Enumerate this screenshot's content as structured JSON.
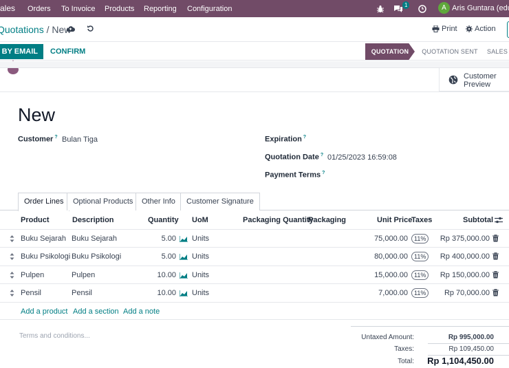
{
  "nav": {
    "app": "Sales",
    "menu": [
      "Orders",
      "To Invoice",
      "Products",
      "Reporting",
      "Configuration"
    ],
    "chat_badge": "1",
    "avatar_letter": "A",
    "user": "Aris Guntara (edu-l"
  },
  "breadcrumb": {
    "parent": "Quotations",
    "sep": "/",
    "current": "New"
  },
  "toolbar": {
    "print": "Print",
    "action": "Action"
  },
  "actions": {
    "send_email": "SEND BY EMAIL",
    "confirm": "CONFIRM"
  },
  "statusbar": {
    "quotation": "QUOTATION",
    "sent": "QUOTATION SENT",
    "sales": "SALES ORDER"
  },
  "preview": {
    "line1": "Customer",
    "line2": "Preview"
  },
  "form": {
    "title": "New",
    "customer_label": "Customer",
    "customer_value": "Bulan Tiga",
    "expiration_label": "Expiration",
    "quotation_date_label": "Quotation Date",
    "quotation_date_value": "01/25/2023 16:59:08",
    "payment_terms_label": "Payment Terms",
    "help": "?"
  },
  "tabs": [
    "Order Lines",
    "Optional Products",
    "Other Info",
    "Customer Signature"
  ],
  "table": {
    "headers": {
      "product": "Product",
      "description": "Description",
      "quantity": "Quantity",
      "uom": "UoM",
      "pkg_qty": "Packaging Quantity",
      "packaging": "Packaging",
      "unit_price": "Unit Price",
      "taxes": "Taxes",
      "subtotal": "Subtotal"
    },
    "rows": [
      {
        "product": "Buku Sejarah",
        "description": "Buku Sejarah",
        "quantity": "5.00",
        "uom": "Units",
        "unit_price": "75,000.00",
        "tax": "11%",
        "subtotal": "Rp 375,000.00"
      },
      {
        "product": "Buku Psikologi",
        "description": "Buku Psikologi",
        "quantity": "5.00",
        "uom": "Units",
        "unit_price": "80,000.00",
        "tax": "11%",
        "subtotal": "Rp 400,000.00"
      },
      {
        "product": "Pulpen",
        "description": "Pulpen",
        "quantity": "10.00",
        "uom": "Units",
        "unit_price": "15,000.00",
        "tax": "11%",
        "subtotal": "Rp 150,000.00"
      },
      {
        "product": "Pensil",
        "description": "Pensil",
        "quantity": "10.00",
        "uom": "Units",
        "unit_price": "7,000.00",
        "tax": "11%",
        "subtotal": "Rp 70,000.00"
      }
    ],
    "add_product": "Add a product",
    "add_section": "Add a section",
    "add_note": "Add a note"
  },
  "footer": {
    "terms_placeholder": "Terms and conditions...",
    "untaxed_label": "Untaxed Amount:",
    "untaxed_value": "Rp 995,000.00",
    "taxes_label": "Taxes:",
    "taxes_value": "Rp 109,450.00",
    "total_label": "Total:",
    "total_value": "Rp 1,104,450.00"
  },
  "colors": {
    "brand": "#714B67",
    "accent": "#017e84"
  }
}
